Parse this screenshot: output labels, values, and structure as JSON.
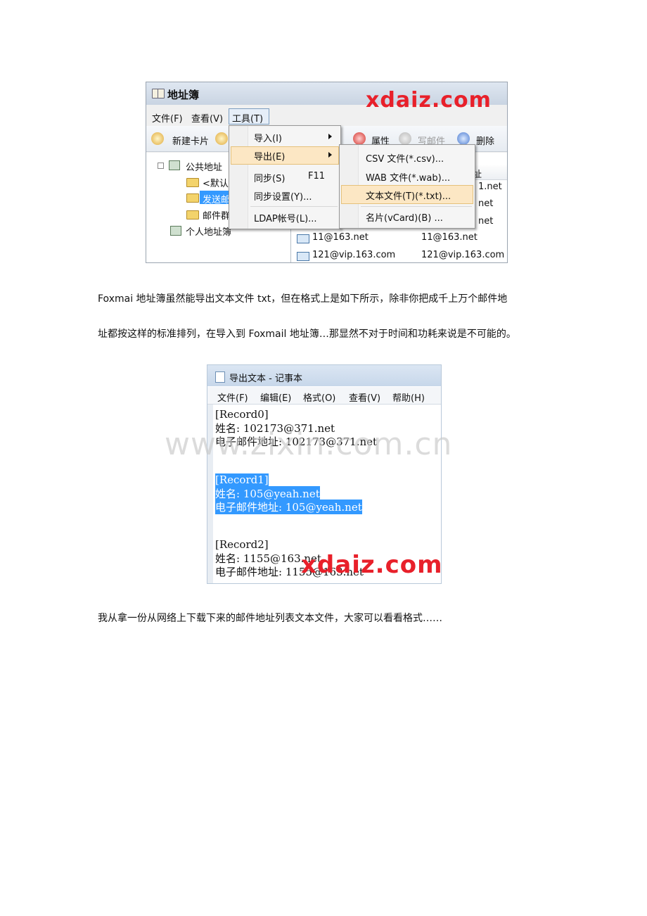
{
  "screenshot1": {
    "title": "地址簿",
    "watermark": "xdaiz.com",
    "menubar": [
      "文件(F)",
      "查看(V)",
      "工具(T)"
    ],
    "toolbar": {
      "new_card": "新建卡片",
      "properties": "属性",
      "write_mail": "写邮件",
      "delete": "删除"
    },
    "tree": [
      {
        "label": "公共地址"
      },
      {
        "label": "<默认"
      },
      {
        "label": "发送邮"
      },
      {
        "label": "邮件群"
      },
      {
        "label": "个人地址簿"
      }
    ],
    "list": {
      "header_tail": "址",
      "partial_rows": [
        "1.net",
        "net",
        "net"
      ],
      "rows": [
        {
          "name": "11@163.net",
          "email": "11@163.net"
        },
        {
          "name": "121@vip.163.com",
          "email": "121@vip.163.com"
        }
      ]
    },
    "tools_menu": [
      {
        "label": "导入(I)",
        "shortcut": ""
      },
      {
        "label": "导出(E)",
        "shortcut": ""
      },
      {
        "label": "同步(S)",
        "shortcut": "F11"
      },
      {
        "label": "同步设置(Y)...",
        "shortcut": ""
      },
      {
        "label": "LDAP帐号(L)...",
        "shortcut": ""
      }
    ],
    "export_submenu": [
      {
        "label": "CSV 文件(*.csv)..."
      },
      {
        "label": "WAB 文件(*.wab)..."
      },
      {
        "label": "文本文件(T)(*.txt)..."
      },
      {
        "label": "名片(vCard)(B) ..."
      }
    ]
  },
  "paragraph1": {
    "line1": "Foxmai 地址簿虽然能导出文本文件 txt，但在格式上是如下所示，除非你把成千上万个邮件地",
    "line2": "址都按这样的标准排列，在导入到 Foxmail 地址簿…那显然不对于时间和功耗来说是不可能的。"
  },
  "screenshot2": {
    "title": "导出文本 - 记事本",
    "menubar": [
      "文件(F)",
      "编辑(E)",
      "格式(O)",
      "查看(V)",
      "帮助(H)"
    ],
    "lines": [
      "[Record0]",
      "姓名: 102173@371.net",
      "电子邮件地址: 102173@371.net",
      "",
      "[Record1]",
      "姓名: 105@yeah.net",
      "电子邮件地址: 105@yeah.net",
      "",
      "",
      "[Record2]",
      "姓名: 1155@163.net",
      "电子邮件地址: 1155@163.net"
    ],
    "background_watermark": "www.zixin.com.cn",
    "watermark": "xdaiz.com"
  },
  "paragraph2": "我从拿一份从网络上下载下来的邮件地址列表文本文件，大家可以看看格式……"
}
